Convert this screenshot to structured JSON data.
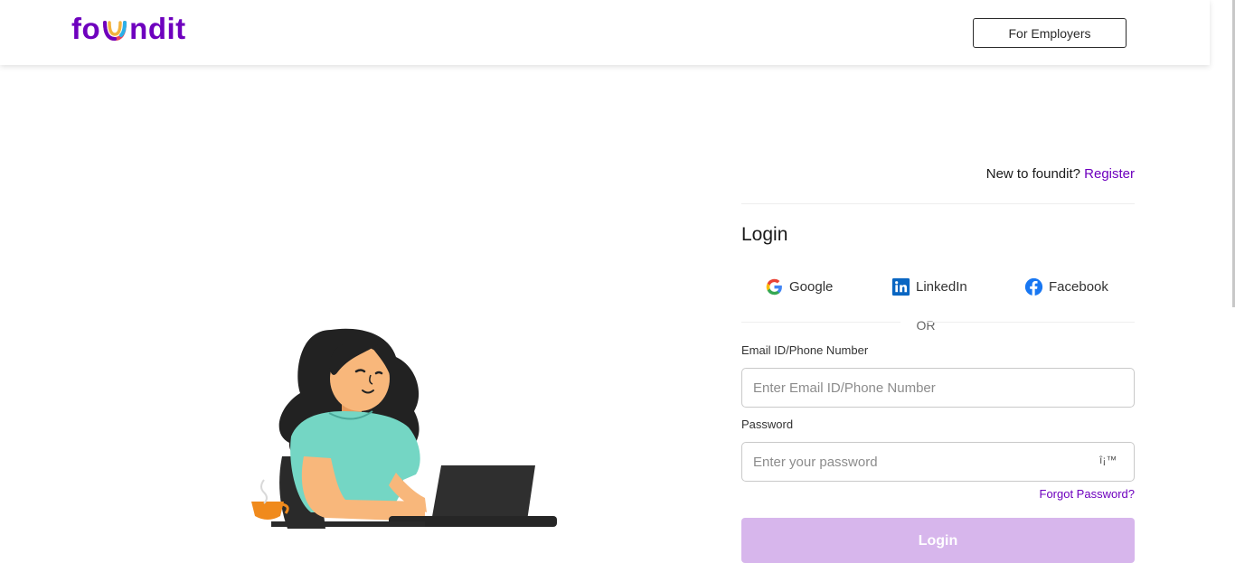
{
  "header": {
    "logo_text_pre": "fo",
    "logo_text_post": "ndit",
    "employers_button": "For Employers"
  },
  "auth": {
    "new_user_prompt": "New to foundit?",
    "register_link": "Register",
    "title": "Login",
    "social": [
      {
        "label": "Google",
        "icon": "google-icon"
      },
      {
        "label": "LinkedIn",
        "icon": "linkedin-icon"
      },
      {
        "label": "Facebook",
        "icon": "facebook-icon"
      }
    ],
    "or_text": "OR",
    "email": {
      "label": "Email ID/Phone Number",
      "placeholder": "Enter Email ID/Phone Number",
      "value": ""
    },
    "password": {
      "label": "Password",
      "placeholder": "Enter your password",
      "value": "",
      "toggle_glyph": "î¡™"
    },
    "forgot_link": "Forgot Password?",
    "login_button": "Login"
  },
  "colors": {
    "brand": "#6e00be",
    "login_button_disabled": "#d7b6ec",
    "border": "#c9c9c9"
  }
}
